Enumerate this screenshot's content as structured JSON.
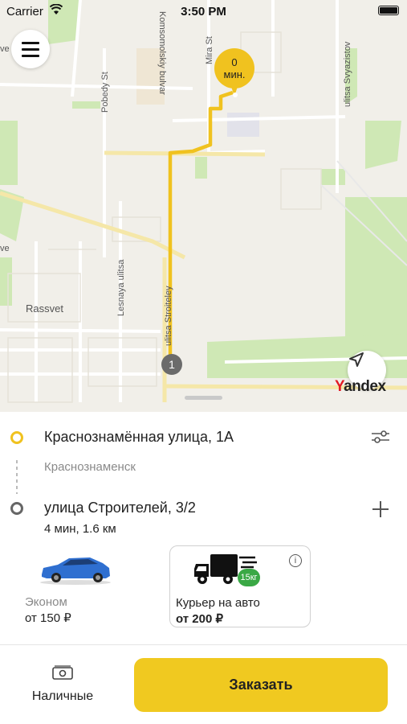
{
  "status_bar": {
    "carrier": "Carrier",
    "time": "3:50 PM"
  },
  "map": {
    "street_labels": {
      "komsomolskiy": "Komsomolskiy bulvar",
      "mira": "Mira St",
      "pobedy": "Pobedy St",
      "svyazistov": "ulitsa Svyazistov",
      "lesnaya": "Lesnaya ulitsa",
      "stroiteley": "ulitsa Stroiteley",
      "rassvet": "Rassvet",
      "edge_ve_top": "ve",
      "edge_ve_mid": "ve"
    },
    "eta_pin": {
      "value": "0",
      "unit": "мин."
    },
    "start_marker": "1",
    "logo": {
      "first": "Y",
      "rest": "andex"
    },
    "route_color": "#f0c21f"
  },
  "route": {
    "from_address": "Краснознамённая улица, 1А",
    "from_city": "Краснознаменск",
    "to_address": "улица Строителей, 3/2",
    "trip_info": "4 мин, 1.6 км"
  },
  "tariffs": [
    {
      "name": "Эконом",
      "price": "от 150 ₽",
      "icon": "car-icon",
      "selected": false
    },
    {
      "name": "Курьер на авто",
      "price": "от 200 ₽",
      "icon": "truck-icon",
      "badge": "15кг",
      "selected": true
    }
  ],
  "payment": {
    "label": "Наличные",
    "icon": "cash-icon"
  },
  "order_button": "Заказать",
  "colors": {
    "accent": "#f0c920",
    "map_background": "#f1efe9",
    "park_green": "#cfe8b5"
  }
}
